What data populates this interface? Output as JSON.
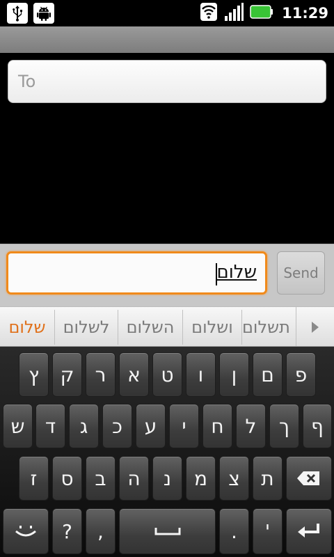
{
  "status_bar": {
    "time": "11:29",
    "left_icons": [
      "usb-icon",
      "android-debug-icon"
    ],
    "right_icons": [
      "wifi-icon",
      "signal-icon",
      "battery-icon"
    ],
    "battery_color": "#39c436"
  },
  "recipient": {
    "placeholder": "To",
    "value": ""
  },
  "compose": {
    "message": "שלום",
    "send_label": "Send",
    "focus_color": "#f08a1b"
  },
  "suggestions": {
    "items": [
      "שלום",
      "לשלום",
      "השלום",
      "ושלום",
      "תשלום"
    ],
    "selected_index": 0,
    "selected_color": "#e0701a",
    "more_icon": "play-arrow-icon"
  },
  "keyboard": {
    "row1": [
      "ץ",
      "ק",
      "ר",
      "א",
      "ט",
      "ו",
      "ן",
      "ם",
      "פ"
    ],
    "row2": [
      "ש",
      "ד",
      "ג",
      "כ",
      "ע",
      "י",
      "ח",
      "ל",
      "ך",
      "ף"
    ],
    "row3": [
      "ז",
      "ס",
      "ב",
      "ה",
      "נ",
      "מ",
      "צ",
      "ת"
    ],
    "row4": [
      ",",
      "?",
      ".",
      "'"
    ],
    "smiley_key": "smiley-icon",
    "space_key": "space-icon",
    "delete_key": "backspace-icon",
    "enter_key": "enter-icon"
  }
}
